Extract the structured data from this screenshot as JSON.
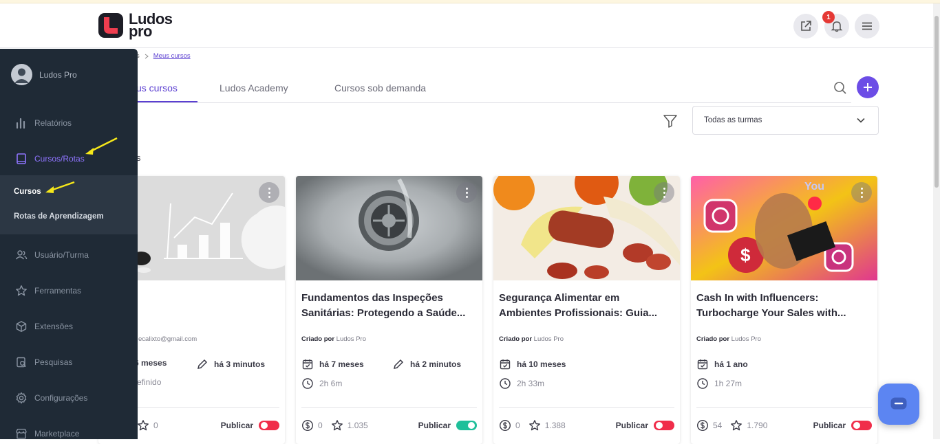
{
  "header": {
    "logo_line1": "Ludos",
    "logo_line2": "pro",
    "notification_count": "1"
  },
  "breadcrumb": {
    "previous": "s",
    "current": "Meus cursos"
  },
  "tabs": [
    {
      "label": "us cursos",
      "active": true
    },
    {
      "label": "Ludos Academy",
      "active": false
    },
    {
      "label": "Cursos sob demanda",
      "active": false
    }
  ],
  "filter": {
    "select_value": "Todas as turmas"
  },
  "section_label": "s",
  "sidebar": {
    "user_name": "Ludos Pro",
    "items": [
      {
        "label": "Relatórios",
        "icon": "bar-chart-icon"
      },
      {
        "label": "Cursos/Rotas",
        "icon": "book-icon",
        "active": true
      },
      {
        "label": "Usuário/Turma",
        "icon": "users-icon"
      },
      {
        "label": "Ferramentas",
        "icon": "star-icon"
      },
      {
        "label": "Extensões",
        "icon": "cube-icon"
      },
      {
        "label": "Pesquisas",
        "icon": "survey-icon"
      },
      {
        "label": "Configurações",
        "icon": "gear-icon"
      },
      {
        "label": "Marketplace",
        "icon": "store-icon"
      }
    ],
    "subitems": [
      {
        "label": "Cursos",
        "active": true
      },
      {
        "label": "Rotas de Aprendizagem",
        "active": false
      }
    ]
  },
  "cards": [
    {
      "title": "",
      "creator_prefix": "",
      "creator": "ecalixto@gmail.com",
      "created": "6 meses",
      "updated": "há 3 minutos",
      "duration": "efinido",
      "price": "",
      "rating": "0",
      "publish_label": "Publicar",
      "published": false
    },
    {
      "title": "Fundamentos das Inspeções Sanitárias: Protegendo a Saúde...",
      "creator_prefix": "Criado por",
      "creator": "Ludos Pro",
      "created": "há 7 meses",
      "updated": "há 2 minutos",
      "duration": "2h 6m",
      "price": "0",
      "rating": "1.035",
      "publish_label": "Publicar",
      "published": true
    },
    {
      "title": "Segurança Alimentar em Ambientes Profissionais: Guia...",
      "creator_prefix": "Criado por",
      "creator": "Ludos Pro",
      "created": "há 10 meses",
      "updated": "",
      "duration": "2h 33m",
      "price": "0",
      "rating": "1.388",
      "publish_label": "Publicar",
      "published": false
    },
    {
      "title": "Cash In with Influencers: Turbocharge Your Sales with...",
      "creator_prefix": "Criado por",
      "creator": "Ludos Pro",
      "created": "há 1 ano",
      "updated": "",
      "duration": "1h 27m",
      "price": "54",
      "rating": "1.790",
      "publish_label": "Publicar",
      "published": false
    }
  ],
  "colors": {
    "accent": "#6c4de6",
    "sidebar_bg": "#1f2a36",
    "toggle_off": "#f02d4a",
    "toggle_on": "#1fbf9a",
    "chat_fab": "#5c85f2"
  }
}
